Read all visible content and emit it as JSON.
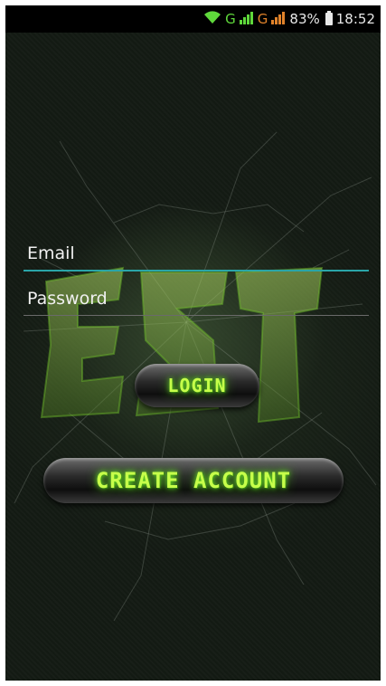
{
  "status_bar": {
    "net1": "G",
    "net2": "G",
    "battery": "83%",
    "time": "18:52"
  },
  "login_form": {
    "email_placeholder": "Email",
    "password_placeholder": "Password",
    "login_label": "LOGIN",
    "create_account_label": "CREATE ACCOUNT"
  },
  "colors": {
    "accent_underline": "#2aa5a8",
    "button_text": "#c6ff4a",
    "background": "#141b14"
  },
  "icons": [
    "wifi-icon",
    "signal-icon",
    "battery-icon"
  ]
}
